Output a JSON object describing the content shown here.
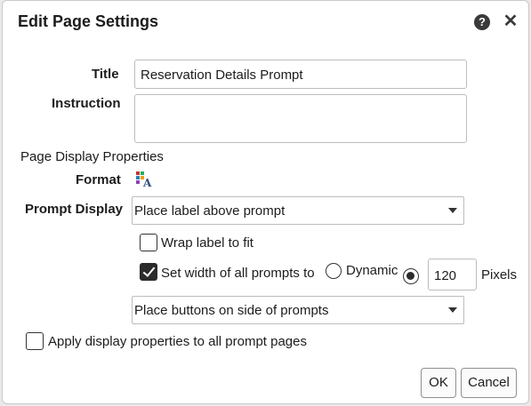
{
  "dialog": {
    "title": "Edit Page Settings",
    "help_icon": "question-circle-icon",
    "close_icon": "close-icon"
  },
  "form": {
    "title_label": "Title",
    "title_value": "Reservation Details Prompt",
    "instruction_label": "Instruction",
    "instruction_value": "",
    "section_label": "Page Display Properties",
    "format_label": "Format",
    "format_icon": "format-text-icon",
    "prompt_display_label": "Prompt Display",
    "prompt_display_value": "Place label above prompt",
    "wrap_label_text": "Wrap label to fit",
    "wrap_label_checked": false,
    "set_width_text": "Set width of all prompts to",
    "set_width_checked": true,
    "dynamic_label": "Dynamic",
    "dynamic_selected": false,
    "width_value": "120",
    "pixels_label": "Pixels",
    "pixels_selected": true,
    "button_placement_value": "Place buttons on side of prompts",
    "apply_all_text": "Apply display properties to all prompt pages",
    "apply_all_checked": false
  },
  "buttons": {
    "ok": "OK",
    "cancel": "Cancel"
  }
}
